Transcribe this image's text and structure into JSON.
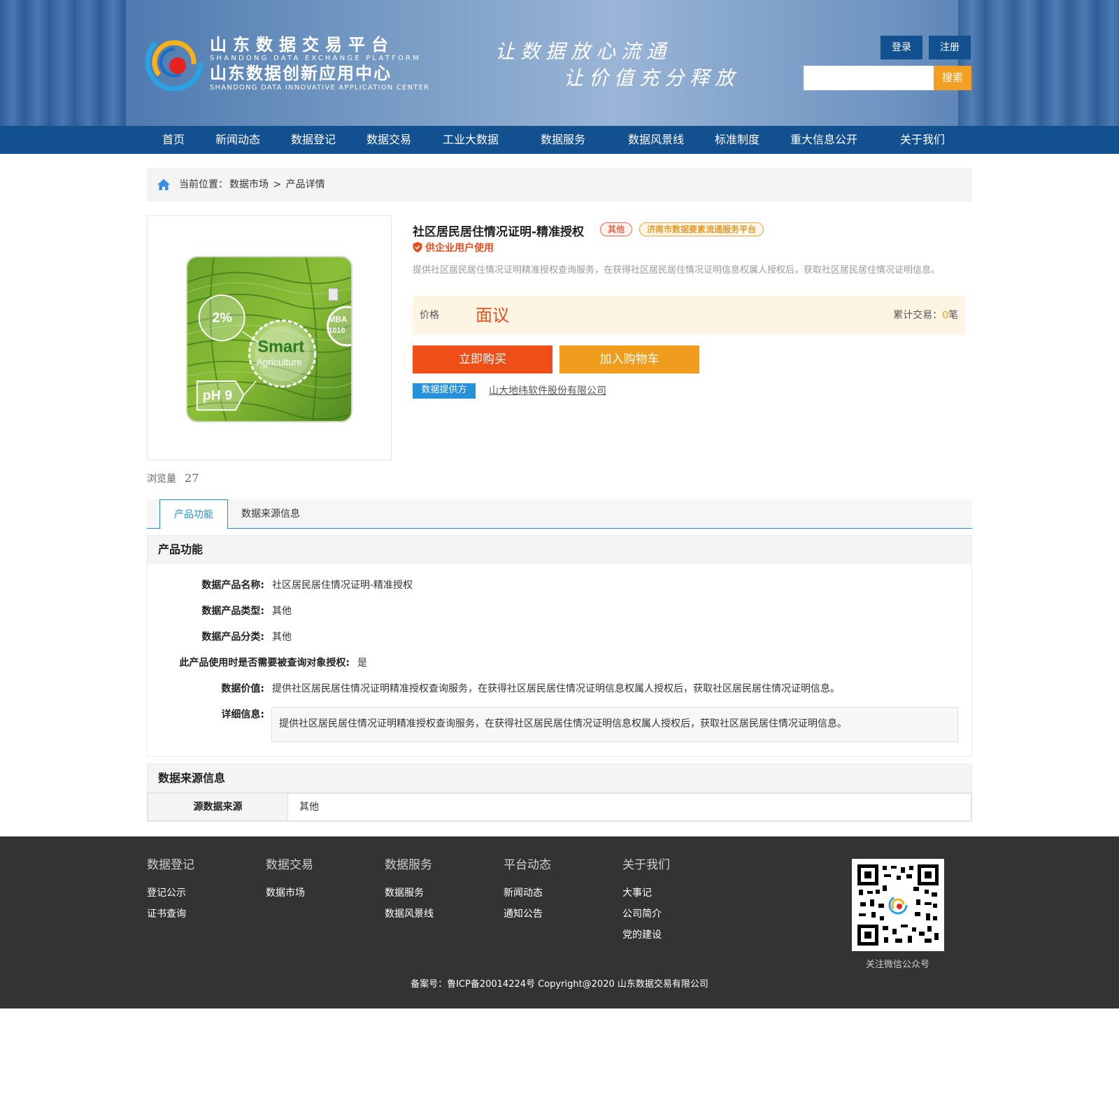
{
  "header": {
    "logo_cn1": "山东数据交易平台",
    "logo_en1": "SHANDONG DATA EXCHANGE PLATFORM",
    "logo_cn2": "山东数据创新应用中心",
    "logo_en2": "SHANDONG DATA INNOVATIVE APPLICATION CENTER",
    "slogan1": "让数据放心流通",
    "slogan2": "让价值充分释放",
    "login_label": "登录",
    "register_label": "注册",
    "search_placeholder": "",
    "search_label": "搜索"
  },
  "nav": {
    "items": [
      "首页",
      "新闻动态",
      "数据登记",
      "数据交易",
      "工业大数据",
      "数据服务",
      "数据风景线",
      "标准制度",
      "重大信息公开",
      "关于我们"
    ]
  },
  "breadcrumb": {
    "prefix": "当前位置：",
    "level1": "数据市场",
    "separator": " > ",
    "level2": "产品详情"
  },
  "product": {
    "image_text": {
      "percent": "2%",
      "smart": "Smart",
      "agriculture": "Agriculture",
      "ph": "pH 9",
      "mba": "MBA",
      "mba_num": "1010"
    },
    "views_label": "浏览量",
    "views_count": "27",
    "title": "社区居民居住情况证明-精准授权",
    "tag_type": "其他",
    "tag_platform": "济南市数据要素流通服务平台",
    "enterprise_only": "供企业用户使用",
    "description": "提供社区居民居住情况证明精准授权查询服务，在获得社区居民居住情况证明信息权属人授权后，获取社区居民居住情况证明信息。",
    "price_label": "价格",
    "price_value": "面议",
    "trade_label": "累计交易：",
    "trade_count": "0",
    "trade_unit": "笔",
    "buy_label": "立即购买",
    "cart_label": "加入购物车",
    "provider_label": "数据提供方",
    "provider_name": "山大地纬软件股份有限公司"
  },
  "tabs": {
    "active": "产品功能",
    "second": "数据来源信息"
  },
  "features": {
    "heading": "产品功能",
    "rows": [
      {
        "label": "数据产品名称:",
        "value": "社区居民居住情况证明-精准授权"
      },
      {
        "label": "数据产品类型:",
        "value": "其他"
      },
      {
        "label": "数据产品分类:",
        "value": "其他"
      },
      {
        "label": "此产品使用时是否需要被查询对象授权:",
        "value": "是"
      },
      {
        "label": "数据价值:",
        "value": "提供社区居民居住情况证明精准授权查询服务，在获得社区居民居住情况证明信息权属人授权后，获取社区居民居住情况证明信息。"
      },
      {
        "label": "详细信息:",
        "value": "提供社区居民居住情况证明精准授权查询服务，在获得社区居民居住情况证明信息权属人授权后，获取社区居民居住情况证明信息。"
      }
    ]
  },
  "source": {
    "heading": "数据来源信息",
    "key": "源数据来源",
    "value": "其他"
  },
  "footer": {
    "columns": [
      {
        "title": "数据登记",
        "links": [
          "登记公示",
          "证书查询"
        ]
      },
      {
        "title": "数据交易",
        "links": [
          "数据市场"
        ]
      },
      {
        "title": "数据服务",
        "links": [
          "数据服务",
          "数据风景线"
        ]
      },
      {
        "title": "平台动态",
        "links": [
          "新闻动态",
          "通知公告"
        ]
      },
      {
        "title": "关于我们",
        "links": [
          "大事记",
          "公司简介",
          "党的建设"
        ]
      }
    ],
    "qr_caption": "关注微信公众号",
    "copyright": "备案号：鲁ICP备20014224号 Copyright@2020 山东数据交易有限公司"
  },
  "colors": {
    "nav_blue": "#13508f",
    "accent_orange": "#ef4e18",
    "cart_orange": "#f09c1c",
    "link_blue": "#2690d9",
    "footer_bg": "#333333"
  }
}
